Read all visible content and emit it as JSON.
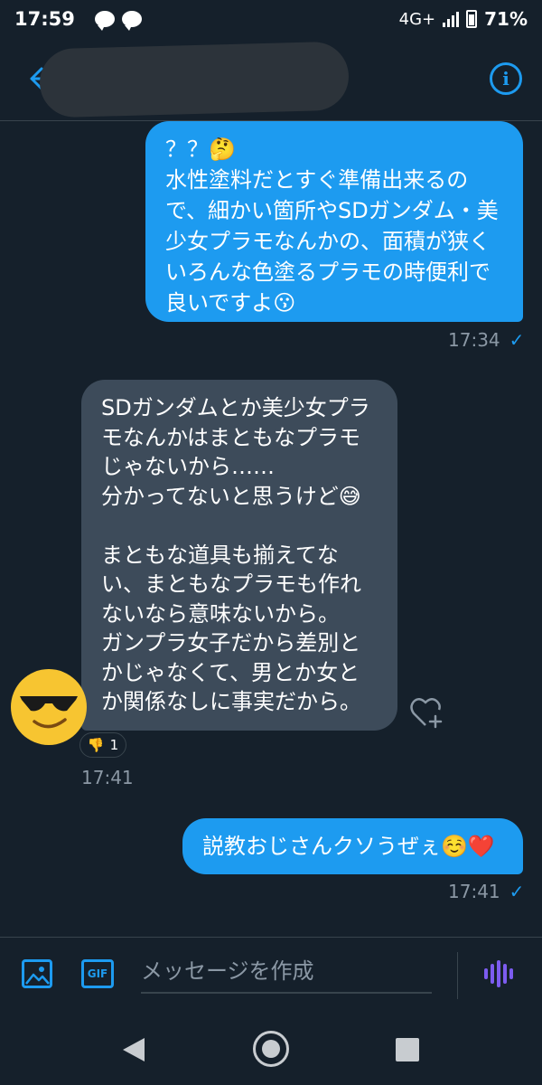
{
  "status_bar": {
    "time": "17:59",
    "network": "4G+",
    "battery": "71%"
  },
  "header": {
    "back_icon": "arrow-left-icon",
    "info_icon": "info-icon"
  },
  "messages": [
    {
      "direction": "outgoing",
      "text": "？？🤔\n水性塗料だとすぐ準備出来るので、細かい箇所やSDガンダム・美少女プラモなんかの、面積が狭くいろんな色塗るプラモの時便利で良いですよ😗",
      "time": "17:34"
    },
    {
      "direction": "incoming",
      "text": "SDガンダムとか美少女プラモなんかはまともなプラモじゃないから……\n分かってないと思うけど😅\n\nまともな道具も揃えてない、まともなプラモも作れないなら意味ないから。\nガンプラ女子だから差別とかじゃなくて、男とか女とか関係なしに事実だから。",
      "reaction_emoji": "👎",
      "reaction_count": "1",
      "time": "17:41"
    },
    {
      "direction": "outgoing",
      "text": "説教おじさんクソうぜぇ☺️❤️",
      "time": "17:41"
    }
  ],
  "composer": {
    "placeholder": "メッセージを作成",
    "gif_label": "GIF"
  },
  "colors": {
    "background": "#15202b",
    "accent": "#1d9bf0",
    "incoming_bubble": "#3d4b5a",
    "voice": "#7c5cf0"
  }
}
